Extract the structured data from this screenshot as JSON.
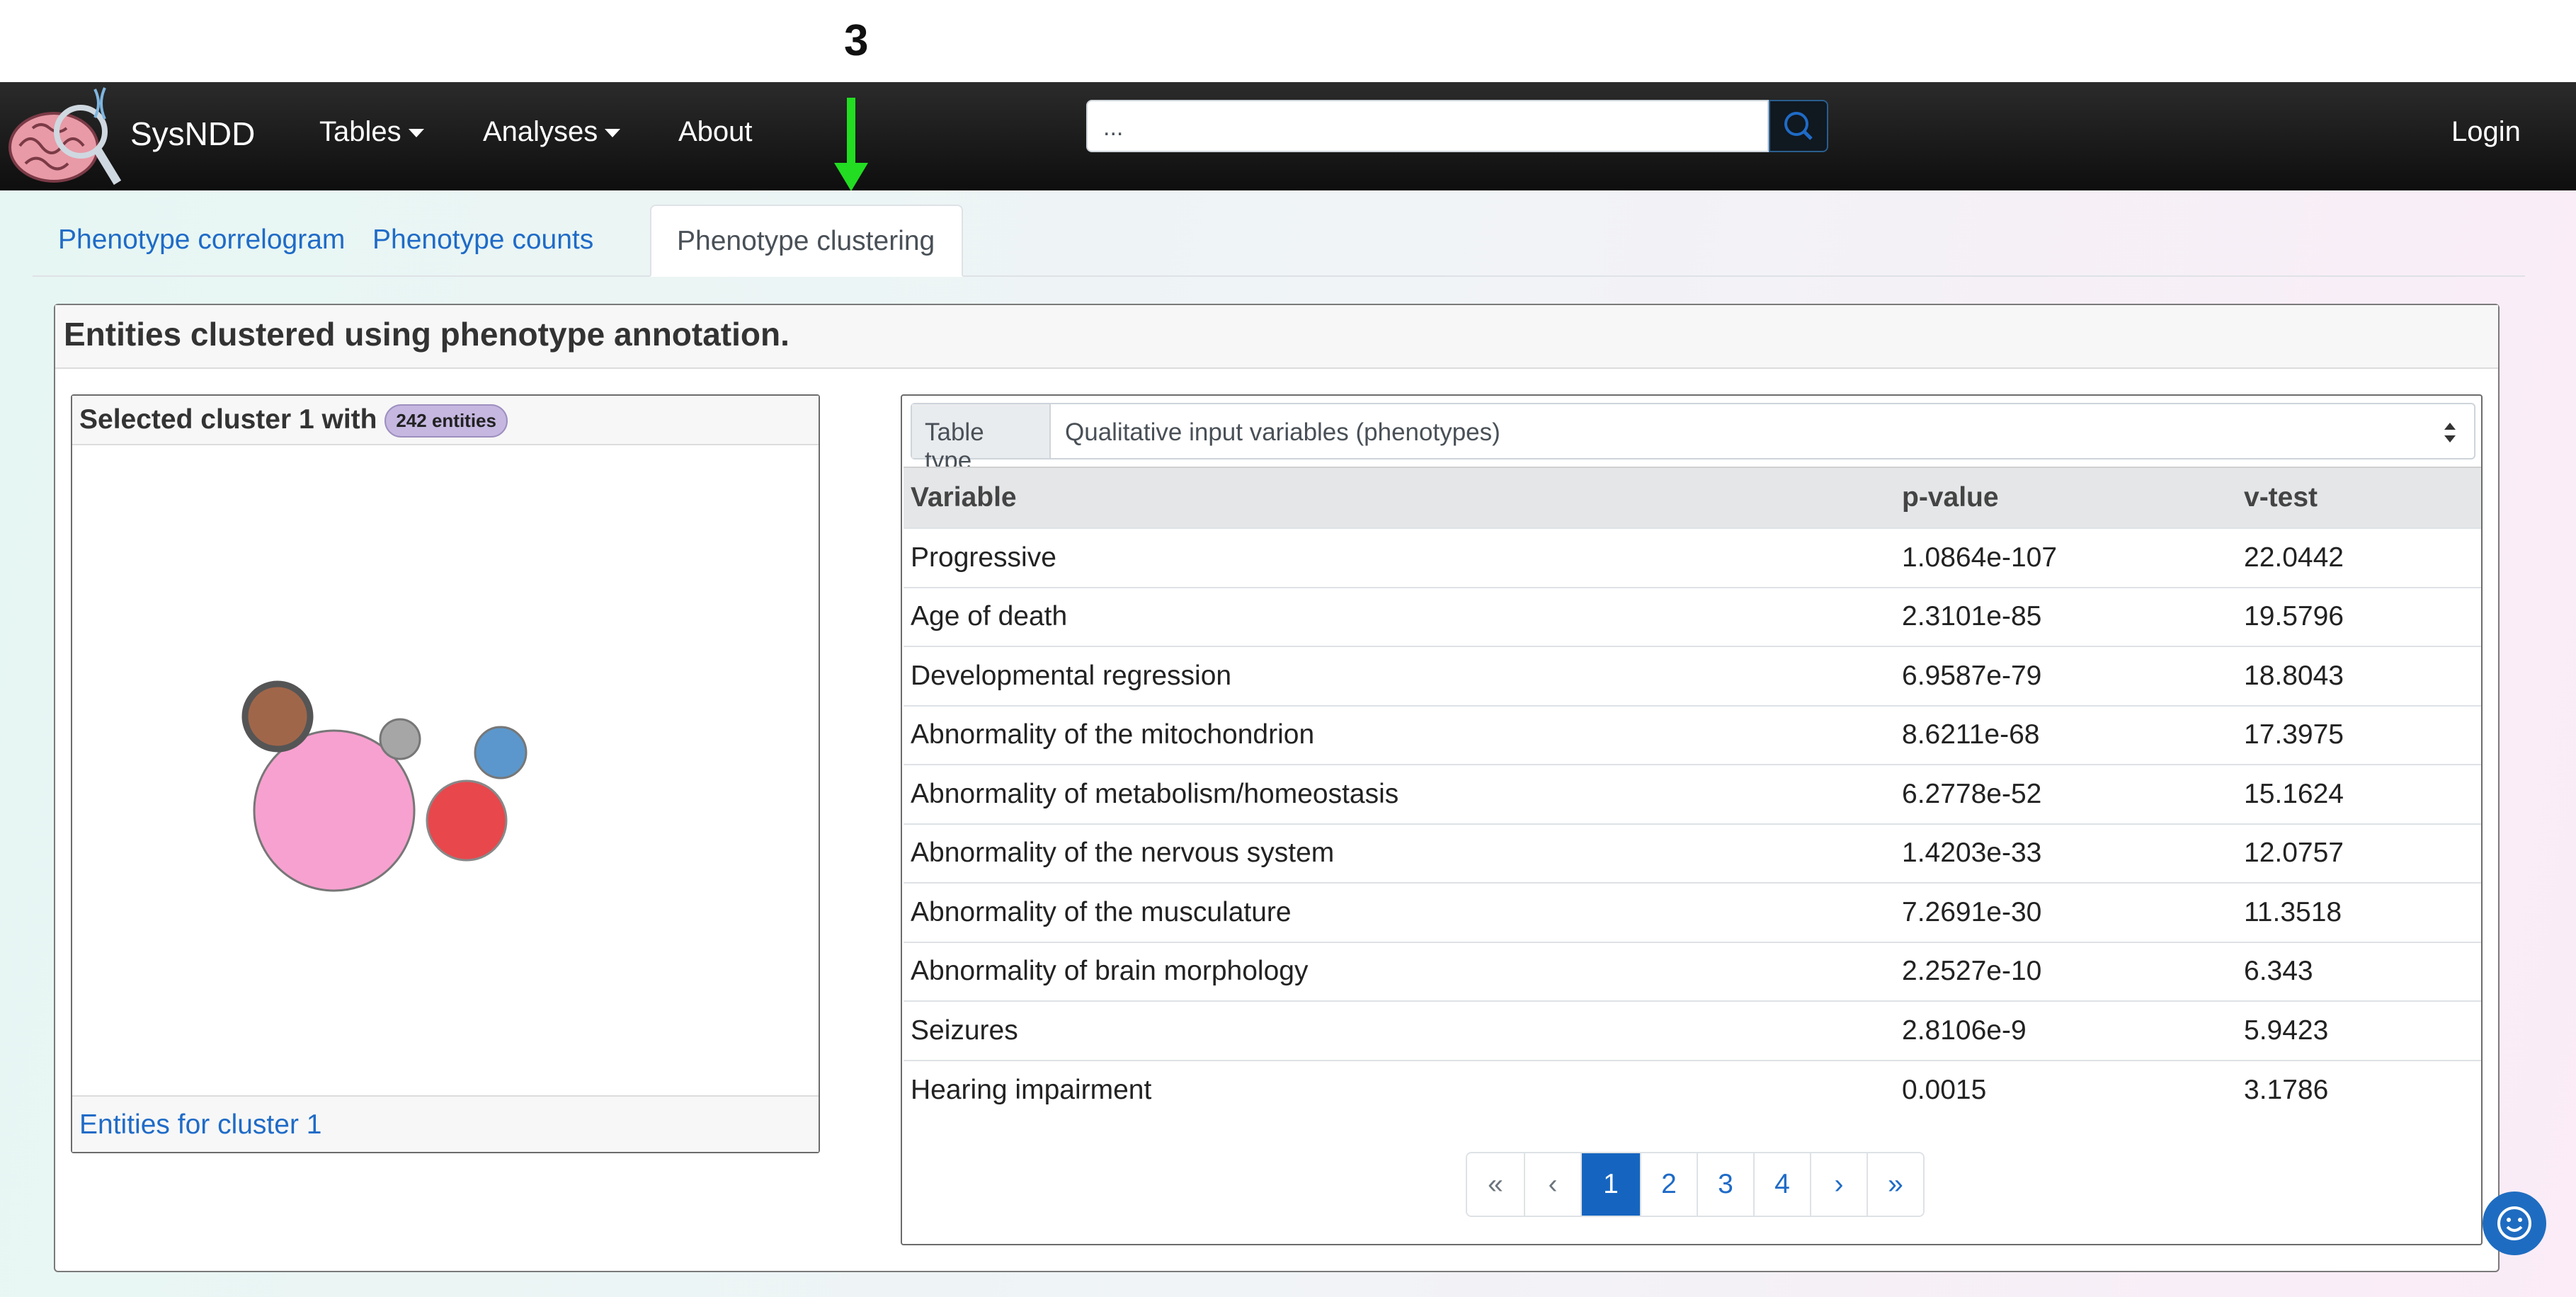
{
  "annotation": {
    "step_number": "3"
  },
  "navbar": {
    "brand": "SysNDD",
    "items": [
      {
        "label": "Tables"
      },
      {
        "label": "Analyses"
      },
      {
        "label": "About"
      }
    ],
    "search": {
      "value": "..."
    },
    "login": "Login"
  },
  "tabs": [
    {
      "label": "Phenotype correlogram",
      "active": false
    },
    {
      "label": "Phenotype counts",
      "active": false
    },
    {
      "label": "Phenotype clustering",
      "active": true
    }
  ],
  "card": {
    "title": "Entities clustered using phenotype annotation.",
    "cluster": {
      "heading": "Selected cluster 1 with",
      "badge": "242 entities",
      "footer_link": "Entities for cluster 1",
      "bubble_colors": [
        "#a0664a",
        "#f7a1d0",
        "#e8474c",
        "#a6a6a6",
        "#5b97cc"
      ]
    },
    "table": {
      "type_label": "Table type",
      "type_value": "Qualitative input variables (phenotypes)",
      "columns": [
        "Variable",
        "p-value",
        "v-test"
      ],
      "rows": [
        [
          "Progressive",
          "1.0864e-107",
          "22.0442"
        ],
        [
          "Age of death",
          "2.3101e-85",
          "19.5796"
        ],
        [
          "Developmental regression",
          "6.9587e-79",
          "18.8043"
        ],
        [
          "Abnormality of the mitochondrion",
          "8.6211e-68",
          "17.3975"
        ],
        [
          "Abnormality of metabolism/homeostasis",
          "6.2778e-52",
          "15.1624"
        ],
        [
          "Abnormality of the nervous system",
          "1.4203e-33",
          "12.0757"
        ],
        [
          "Abnormality of the musculature",
          "7.2691e-30",
          "11.3518"
        ],
        [
          "Abnormality of brain morphology",
          "2.2527e-10",
          "6.343"
        ],
        [
          "Seizures",
          "2.8106e-9",
          "5.9423"
        ],
        [
          "Hearing impairment",
          "0.0015",
          "3.1786"
        ]
      ],
      "pagination": {
        "first": "«",
        "prev": "‹",
        "pages": [
          "1",
          "2",
          "3",
          "4"
        ],
        "current": "1",
        "next": "›",
        "last": "»"
      }
    }
  },
  "colors": {
    "link": "#1f6bc7",
    "active_page": "#1565c0",
    "arrow": "#22dd22"
  }
}
